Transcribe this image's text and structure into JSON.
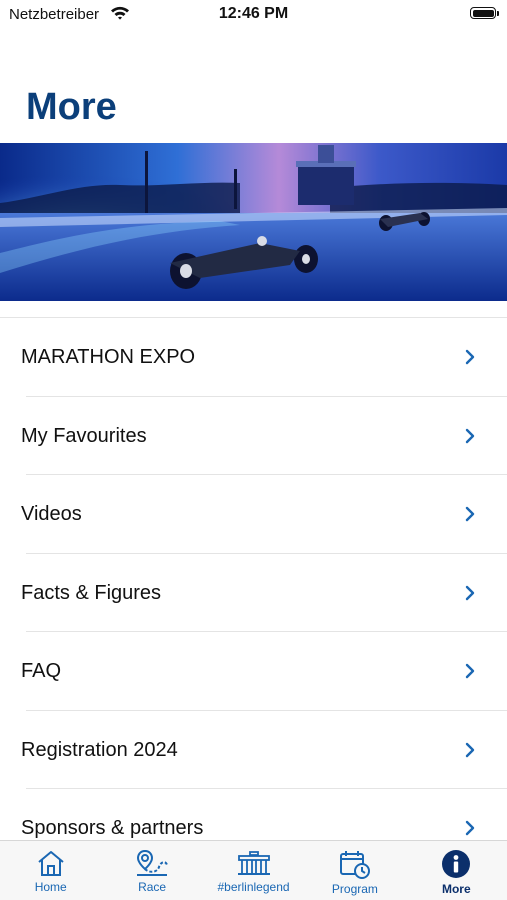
{
  "status_bar": {
    "carrier": "Netzbetreiber",
    "time": "12:46 PM",
    "icons": [
      "wifi-icon",
      "battery-icon"
    ]
  },
  "page": {
    "title": "More"
  },
  "menu": {
    "items": [
      {
        "label": "MARATHON EXPO"
      },
      {
        "label": "My Favourites"
      },
      {
        "label": "Videos"
      },
      {
        "label": "Facts & Figures"
      },
      {
        "label": "FAQ"
      },
      {
        "label": "Registration 2024"
      },
      {
        "label": "Sponsors & partners"
      }
    ],
    "chevron_icon": "chevron-right-icon"
  },
  "tab_bar": {
    "tabs": [
      {
        "label": "Home",
        "icon": "home-icon"
      },
      {
        "label": "Race",
        "icon": "race-map-icon"
      },
      {
        "label": "#berlinlegend",
        "icon": "brandenburg-gate-icon"
      },
      {
        "label": "Program",
        "icon": "calendar-clock-icon"
      },
      {
        "label": "More",
        "icon": "info-icon",
        "active": true
      }
    ]
  },
  "colors": {
    "title": "#0b3f7a",
    "accent": "#1a67b3",
    "active_tab": "#0b2f6b",
    "chevron": "#1a67b3"
  }
}
